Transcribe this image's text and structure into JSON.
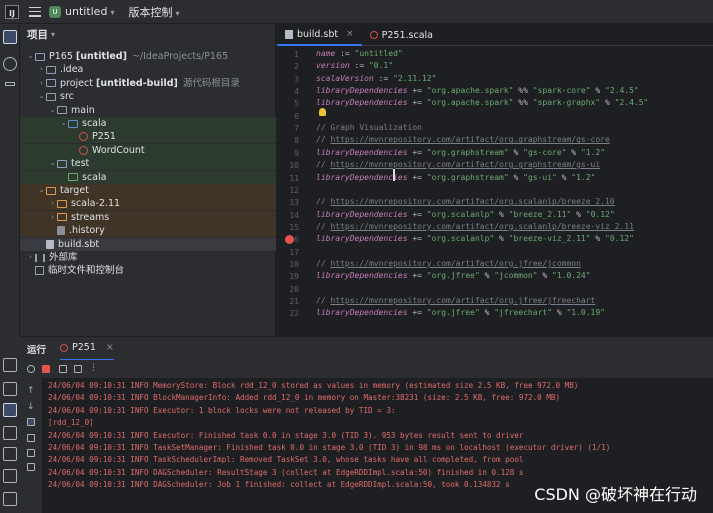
{
  "titlebar": {
    "logo": "IJ",
    "project_badge": "U",
    "project_name": "untitled",
    "vcs_menu": "版本控制"
  },
  "project_panel": {
    "title": "项目",
    "tree": [
      {
        "label": "P165",
        "bold_suffix": "[untitled]",
        "path": "~/IdeaProjects/P165",
        "depth": 0,
        "expanded": true,
        "icon": "module-folder-icon"
      },
      {
        "label": ".idea",
        "depth": 1,
        "expanded": false,
        "icon": "folder-icon"
      },
      {
        "label": "project",
        "bold_suffix": "[untitled-build]",
        "path": "源代码根目录",
        "depth": 1,
        "expanded": false,
        "icon": "folder-icon"
      },
      {
        "label": "src",
        "depth": 1,
        "expanded": true,
        "icon": "folder-icon"
      },
      {
        "label": "main",
        "depth": 2,
        "expanded": true,
        "icon": "folder-icon"
      },
      {
        "label": "scala",
        "depth": 3,
        "expanded": true,
        "icon": "source-folder-icon"
      },
      {
        "label": "P251",
        "depth": 4,
        "icon": "scala-object-icon"
      },
      {
        "label": "WordCount",
        "depth": 4,
        "icon": "scala-object-icon"
      },
      {
        "label": "test",
        "depth": 2,
        "expanded": true,
        "icon": "folder-icon"
      },
      {
        "label": "scala",
        "depth": 3,
        "icon": "test-folder-icon"
      },
      {
        "label": "target",
        "depth": 1,
        "expanded": true,
        "icon": "excluded-folder-icon"
      },
      {
        "label": "scala-2.11",
        "depth": 2,
        "expanded": false,
        "icon": "excluded-folder-icon"
      },
      {
        "label": "streams",
        "depth": 2,
        "expanded": false,
        "icon": "excluded-folder-icon"
      },
      {
        "label": ".history",
        "depth": 2,
        "icon": "file-icon"
      },
      {
        "label": "build.sbt",
        "depth": 1,
        "icon": "sbt-file-icon"
      },
      {
        "label": "外部库",
        "depth": 0,
        "expanded": false,
        "icon": "library-icon"
      },
      {
        "label": "临时文件和控制台",
        "depth": 0,
        "icon": "scratch-icon"
      }
    ]
  },
  "editor": {
    "tabs": [
      {
        "label": "build.sbt",
        "active": true,
        "close": "×"
      },
      {
        "label": "P251.scala",
        "active": false
      }
    ],
    "lines": [
      {
        "n": "1",
        "html": "<span class=\"kw\">name</span> := <span class=\"str\">\"untitled\"</span>"
      },
      {
        "n": "2",
        "html": "<span class=\"kw\">version</span> := <span class=\"str\">\"0.1\"</span>"
      },
      {
        "n": "3",
        "html": "<span class=\"kw\">scalaVersion</span> := <span class=\"str\">\"2.11.12\"</span>"
      },
      {
        "n": "4",
        "html": "<span class=\"kw\">libraryDependencies</span> += <span class=\"str\">\"org.apache.spark\"</span> %% <span class=\"str\">\"spark-core\"</span> % <span class=\"str\">\"2.4.5\"</span>"
      },
      {
        "n": "5",
        "html": "<span class=\"kw\">libraryDependencies</span> += <span class=\"str\">\"org.apache.spark\"</span> %% <span class=\"str\">\"spark-graphx\"</span> % <span class=\"str\">\"2.4.5\"</span>"
      },
      {
        "n": "6",
        "html": ""
      },
      {
        "n": "7",
        "html": "<span class=\"cm\">// Graph Visualization</span>"
      },
      {
        "n": "8",
        "html": "<span class=\"cm\">// </span><span class=\"url\">https://mvnrepository.com/artifact/org.graphstream/gs-core</span>"
      },
      {
        "n": "9",
        "html": "<span class=\"kw\">libraryDependencies</span> += <span class=\"str\">\"org.graphstream\"</span> % <span class=\"str\">\"gs-core\"</span> % <span class=\"str\">\"1.2\"</span>"
      },
      {
        "n": "10",
        "html": "<span class=\"cm\">// </span><span class=\"url\">https://mvnrepository.com/artifact/org.graphstream/gs-ui</span>"
      },
      {
        "n": "11",
        "html": "<span class=\"kw\">libraryDependencies</span> += <span class=\"str\">\"org.graphstream\"</span> % <span class=\"str\">\"gs-ui\"</span> % <span class=\"str\">\"1.2\"</span>"
      },
      {
        "n": "12",
        "html": ""
      },
      {
        "n": "13",
        "html": "<span class=\"cm\">// </span><span class=\"url\">https://mvnrepository.com/artifact/org.scalanlp/breeze_2.10</span>"
      },
      {
        "n": "14",
        "html": "<span class=\"kw\">libraryDependencies</span> += <span class=\"str\">\"org.scalanlp\"</span> % <span class=\"str\">\"breeze_2.11\"</span> % <span class=\"str\">\"0.12\"</span>"
      },
      {
        "n": "15",
        "html": "<span class=\"cm\">// </span><span class=\"url\">https://mvnrepository.com/artifact/org.scalanlp/breeze-viz_2.11</span>"
      },
      {
        "n": "16",
        "html": "<span class=\"kw\">libraryDependencies</span> += <span class=\"str\">\"org.scalanlp\"</span> % <span class=\"str\">\"breeze-viz_2.11\"</span> % <span class=\"str\">\"0.12\"</span>",
        "breakpoint": true
      },
      {
        "n": "17",
        "html": ""
      },
      {
        "n": "18",
        "html": "<span class=\"cm\">// </span><span class=\"url\">https://mvnrepository.com/artifact/org.jfree/jcommon</span>"
      },
      {
        "n": "19",
        "html": "<span class=\"kw\">libraryDependencies</span> += <span class=\"str\">\"org.jfree\"</span> % <span class=\"str\">\"jcommon\"</span> % <span class=\"str\">\"1.0.24\"</span>"
      },
      {
        "n": "20",
        "html": ""
      },
      {
        "n": "21",
        "html": "<span class=\"cm\">// </span><span class=\"url\">https://mvnrepository.com/artifact/org.jfree/jfreechart</span>"
      },
      {
        "n": "22",
        "html": "<span class=\"kw\">libraryDependencies</span> += <span class=\"str\">\"org.jfree\"</span> % <span class=\"str\">\"jfreechart\"</span> % <span class=\"str\">\"1.0.19\"</span>"
      }
    ]
  },
  "run_panel": {
    "title": "运行",
    "tab_label": "P251",
    "tab_close": "×",
    "logs": [
      "24/06/04 09:10:31 INFO MemoryStore: Block rdd_12_0 stored as values in memory (estimated size 2.5 KB, free 972.0 MB)",
      "24/06/04 09:10:31 INFO BlockManagerInfo: Added rdd_12_0 in memory on Master:38231 (size: 2.5 KB, free: 972.0 MB)",
      "24/06/04 09:10:31 INFO Executor: 1 block locks were not released by TID = 3:",
      "[rdd_12_0]",
      "24/06/04 09:10:31 INFO Executor: Finished task 0.0 in stage 3.0 (TID 3). 953 bytes result sent to driver",
      "24/06/04 09:10:31 INFO TaskSetManager: Finished task 0.0 in stage 3.0 (TID 3) in 98 ms on localhost (executor driver) (1/1)",
      "24/06/04 09:10:31 INFO TaskSchedulerImpl: Removed TaskSet 3.0, whose tasks have all completed, from pool",
      "24/06/04 09:10:31 INFO DAGScheduler: ResultStage 3 (collect at EdgeRDDImpl.scala:50) finished in 0.128 s",
      "24/06/04 09:10:31 INFO DAGScheduler: Job 1 finished: collect at EdgeRDDImpl.scala:50, took 0.134832 s"
    ]
  },
  "watermark": "CSDN @破坏神在行动"
}
